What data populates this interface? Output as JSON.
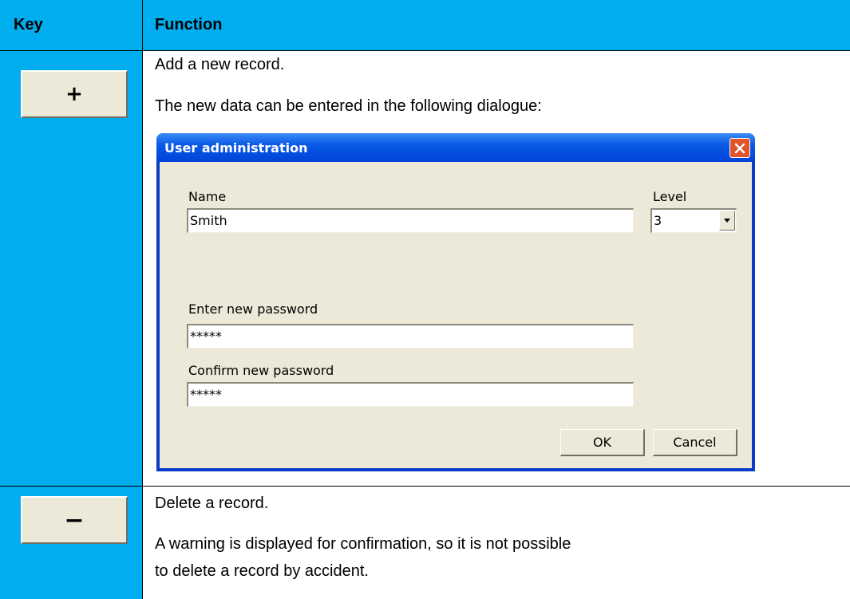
{
  "header": {
    "key_label": "Key",
    "function_label": "Function"
  },
  "rows": [
    {
      "key_symbol": "+",
      "lines": [
        "Add a new record.",
        "The new data can be entered in the following dialogue:"
      ]
    },
    {
      "key_symbol": "−",
      "lines": [
        "Delete a record.",
        "A warning is displayed for confirmation, so it is not possible",
        "to delete a record by accident."
      ]
    }
  ],
  "dialog": {
    "title": "User administration",
    "name_label": "Name",
    "name_value": "Smith",
    "level_label": "Level",
    "level_value": "3",
    "enter_password_label": "Enter new password",
    "enter_password_value": "*****",
    "confirm_password_label": "Confirm new password",
    "confirm_password_value": "*****",
    "ok_label": "OK",
    "cancel_label": "Cancel"
  },
  "colors": {
    "header_blue": "#00aeef",
    "titlebar_blue": "#0a5ae6",
    "button_face": "#ece9d8",
    "close_red": "#e0552c"
  },
  "icons": {
    "close": "close-icon",
    "dropdown": "chevron-down-icon"
  }
}
